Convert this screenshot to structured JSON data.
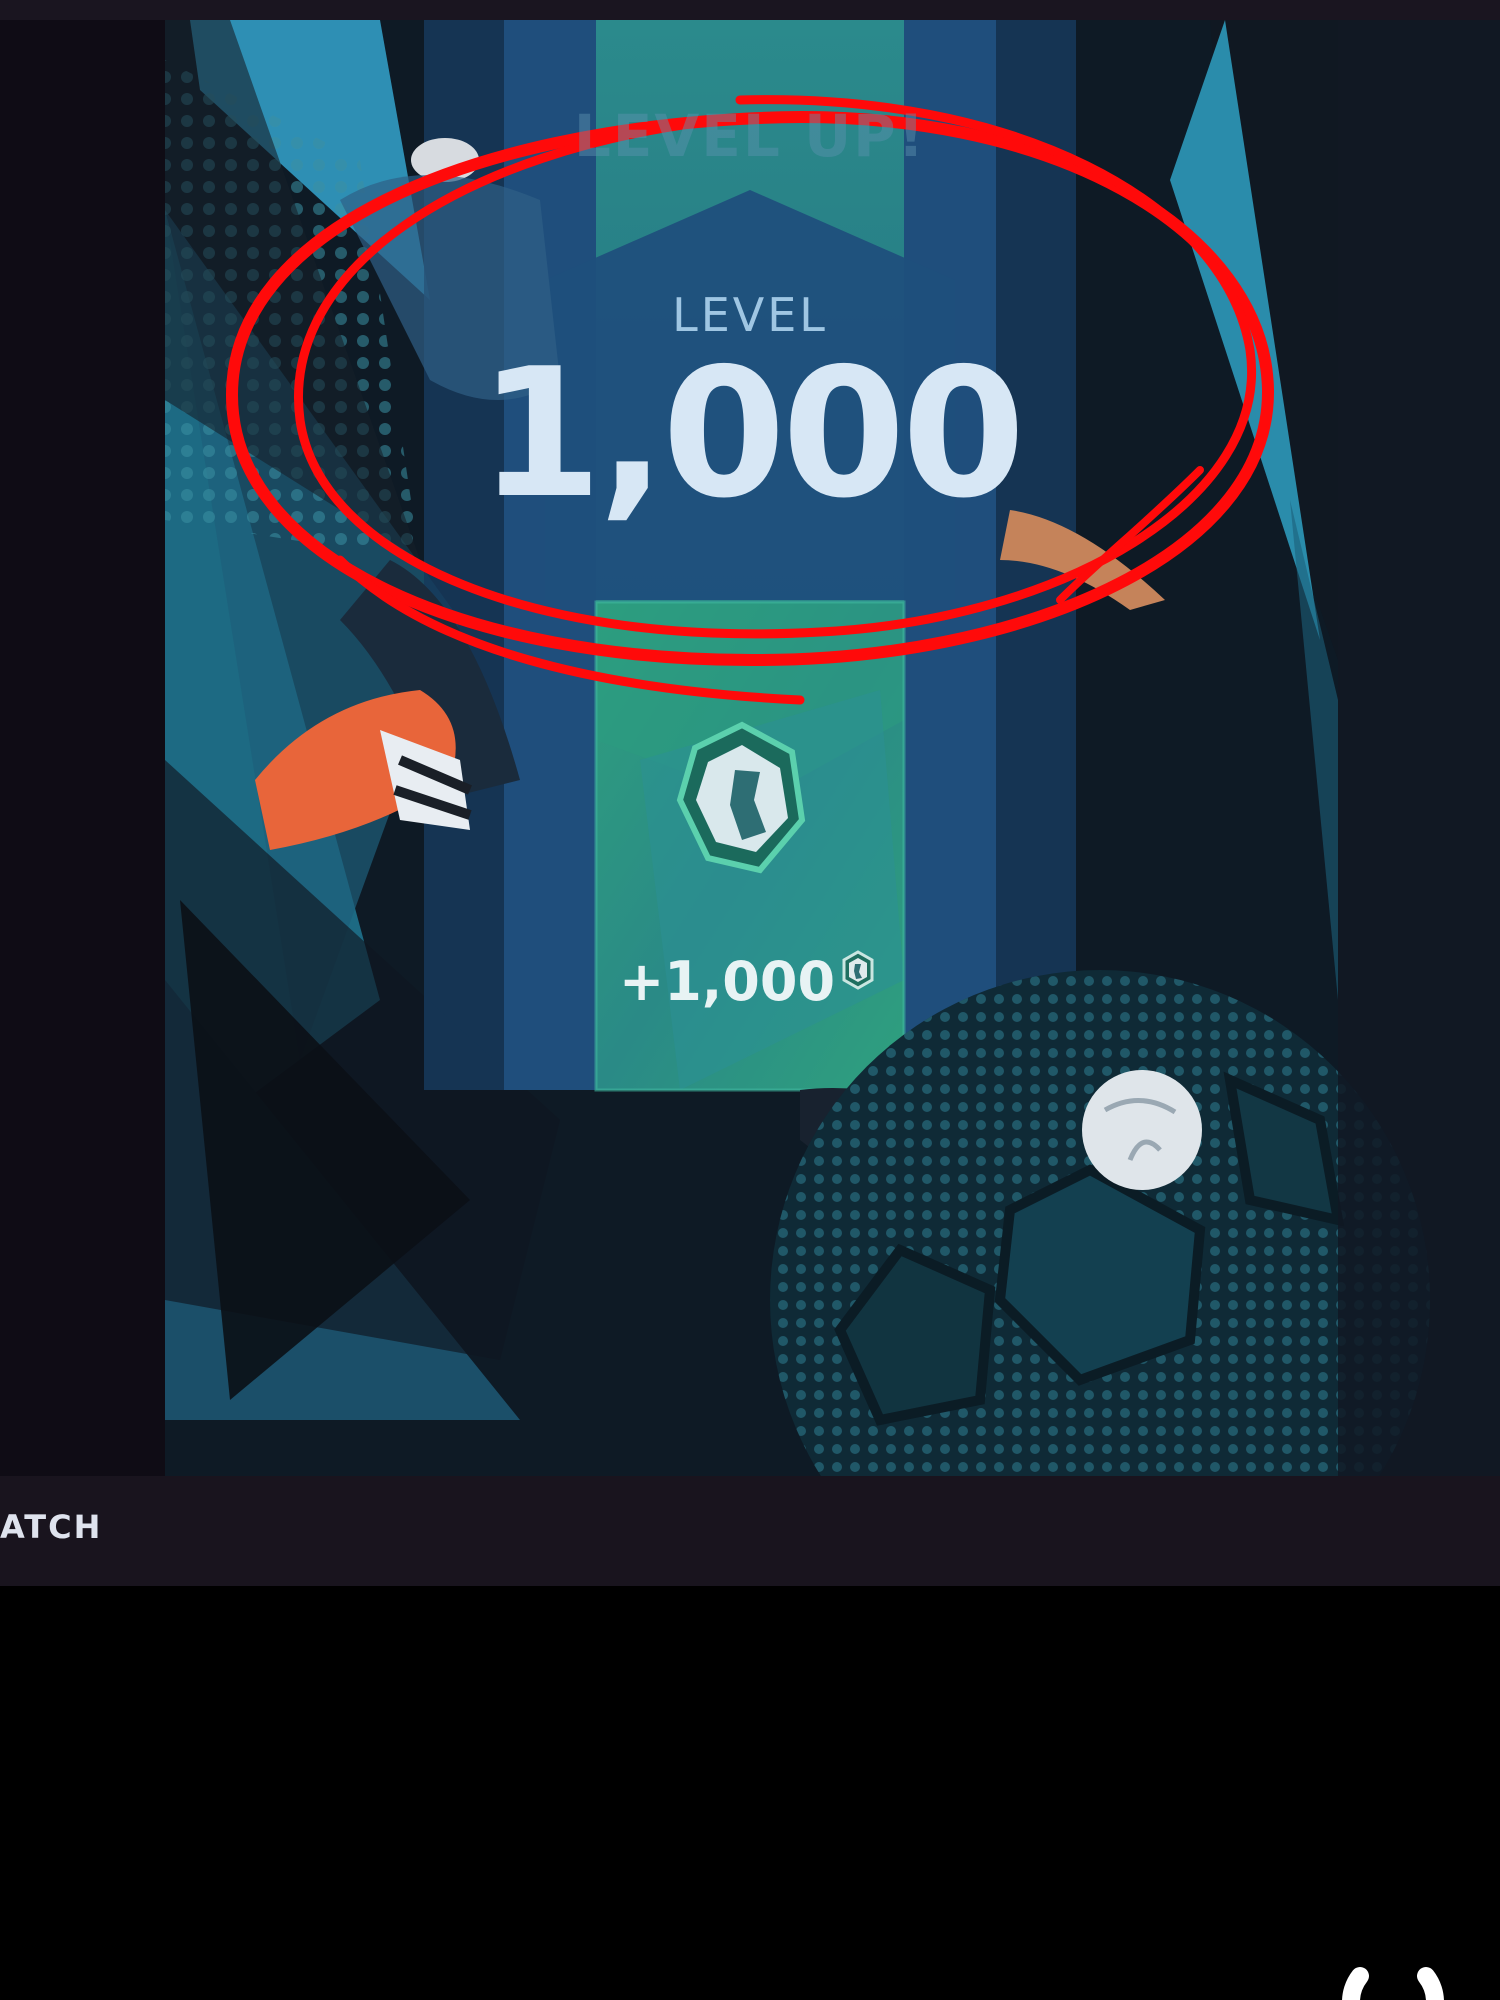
{
  "level_card": {
    "banner_ghost_text": "LEVEL UP!",
    "level_label": "LEVEL",
    "level_value": "1,000"
  },
  "reward": {
    "amount": "+1,000",
    "currency_icon": "coin-token-icon"
  },
  "bottom_bar": {
    "label": "ATCH"
  },
  "annotation": {
    "type": "red-circle-highlight",
    "color": "#ff0a0a"
  },
  "loading": {
    "icon": "loading-spinner-icon"
  },
  "colors": {
    "teal": "#2e8c8c",
    "blue_panel": "#2a5f8f",
    "reward_green": "#2e9a78",
    "background_dark": "#120f1a",
    "cleat_orange": "#e8653a"
  }
}
